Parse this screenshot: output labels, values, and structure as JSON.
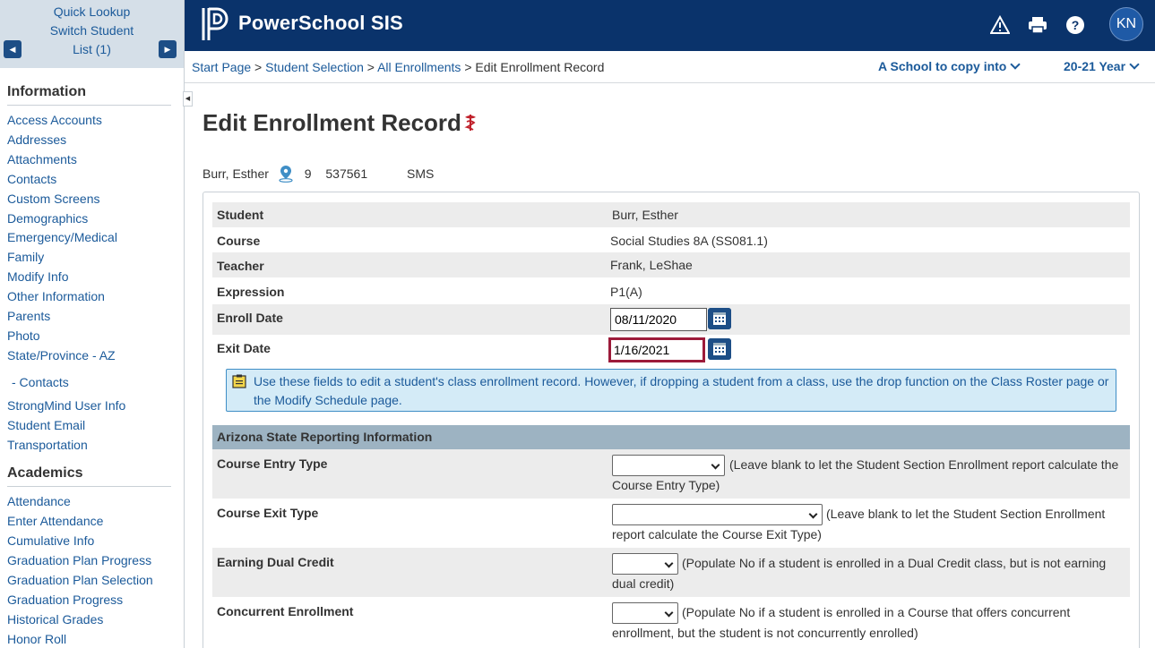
{
  "sidebar": {
    "quick_lookup": "Quick Lookup",
    "switch_student": "Switch Student",
    "list": "List (1)",
    "information_heading": "Information",
    "information_items": [
      "Access Accounts",
      "Addresses",
      "Attachments",
      "Contacts",
      "Custom Screens",
      "Demographics",
      "Emergency/Medical",
      "Family",
      "Modify Info",
      "Other Information",
      "Parents",
      "Photo",
      "State/Province - AZ",
      " - Contacts",
      "StrongMind User Info",
      "Student Email",
      "Transportation"
    ],
    "academics_heading": "Academics",
    "academics_items": [
      "Attendance",
      "Enter Attendance",
      "Cumulative Info",
      "Graduation Plan Progress",
      "Graduation Plan Selection",
      "Graduation Progress",
      "Historical Grades",
      "Honor Roll"
    ]
  },
  "header": {
    "app_name": "PowerSchool SIS",
    "avatar_initials": "KN"
  },
  "breadcrumb": {
    "start_page": "Start Page",
    "student_selection": "Student Selection",
    "all_enrollments": "All Enrollments",
    "current": "Edit Enrollment Record",
    "sep": " > "
  },
  "scope": {
    "school": "A School to copy into",
    "year": "20-21 Year"
  },
  "page": {
    "title": "Edit Enrollment Record",
    "student_name": "Burr, Esther",
    "grade": "9",
    "student_number": "537561",
    "school": "SMS"
  },
  "form": {
    "student_label": "Student",
    "student_value": "Burr, Esther",
    "course_label": "Course",
    "course_value": "Social Studies 8A (SS081.1)",
    "teacher_label": "Teacher",
    "teacher_value": "Frank, LeShae",
    "expression_label": "Expression",
    "expression_value": "P1(A)",
    "enroll_date_label": "Enroll Date",
    "enroll_date_value": "08/11/2020",
    "exit_date_label": "Exit Date",
    "exit_date_value": "1/16/2021",
    "info_message": "Use these fields to edit a student's class enrollment record. However, if dropping a student from a class, use the drop function on the Class Roster page or the Modify Schedule page."
  },
  "state_reporting": {
    "heading": "Arizona State Reporting Information",
    "course_entry_label": "Course Entry Type",
    "course_entry_note": "(Leave blank to let the Student Section Enrollment report calculate the Course Entry Type)",
    "course_exit_label": "Course Exit Type",
    "course_exit_note": "(Leave blank to let the Student Section Enrollment report calculate the Course Exit Type)",
    "dual_credit_label": "Earning Dual Credit",
    "dual_credit_note": "(Populate No if a student is enrolled in a Dual Credit class, but is not earning dual credit)",
    "concurrent_label": "Concurrent Enrollment",
    "concurrent_note": "(Populate No if a student is enrolled in a Course that offers concurrent enrollment, but the student is not concurrently enrolled)"
  }
}
